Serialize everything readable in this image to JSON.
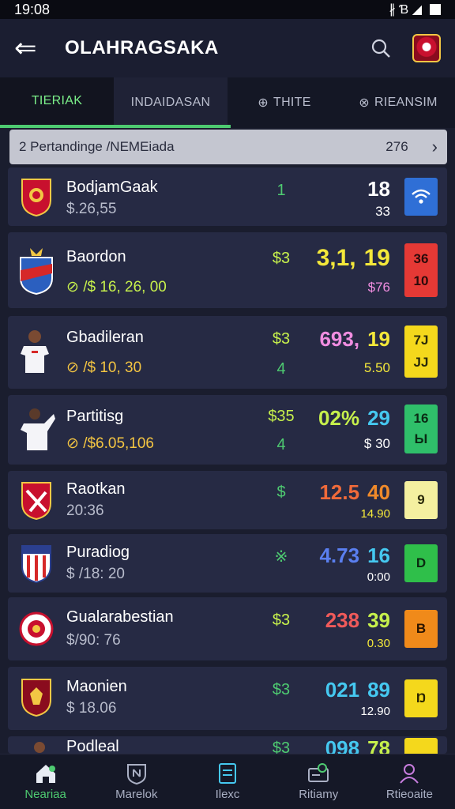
{
  "status": {
    "time": "19:08",
    "icons": "∦ Ɓ ◢"
  },
  "header": {
    "title": "OLAHRAGSAKA",
    "back": "⇐"
  },
  "tabs": [
    {
      "label": "TIERIAK",
      "icon": ""
    },
    {
      "label": "INDAIDASAN",
      "icon": ""
    },
    {
      "label": "THITE",
      "icon": "⊕"
    },
    {
      "label": "RIEANSIM",
      "icon": "⊗"
    }
  ],
  "summary": {
    "title": "2 Pertandinge /NEMEiada",
    "count": "276",
    "arrow": "›"
  },
  "rows": [
    {
      "name": "BodjamGaak",
      "sub": "$.26,55",
      "mid": "1",
      "score_a": "",
      "score_b": "18",
      "odds": "33",
      "box": "((·",
      "colors": {
        "mid": "#4ecb71",
        "score_a": "#ffffff",
        "score_b": "#ffffff",
        "box": "#2f6fd6",
        "sub": "#b8bccc"
      }
    },
    {
      "name": "Baordon",
      "sub": "⊘ /$ 16, 26, 00",
      "mid": "$3",
      "score_a": "3,1,",
      "score_b": "19",
      "odds": "$76",
      "box": "36\n10",
      "colors": {
        "mid": "#c6f04c",
        "score_a": "#f4e83a",
        "score_b": "#f4e83a",
        "box": "#e53935",
        "sub": "#c6f04c"
      }
    },
    {
      "name": "Gbadileran",
      "sub": "⊘ /$ 10, 30",
      "mid": "$3",
      "score_a": "693,",
      "score_b": "19",
      "odds": "5.50",
      "box": "7J\nJJ",
      "colors": {
        "mid": "#c6f04c",
        "score_a": "#f08de0",
        "score_b": "#f4e83a",
        "box": "#f4d81c",
        "sub": "#f4c542"
      }
    },
    {
      "name": "Partitisg",
      "sub": "⊘ /$6.05,106",
      "mid": "$35",
      "score_a": "02%",
      "score_b": "29",
      "odds": "$ 30",
      "box": "16\nЫ",
      "colors": {
        "mid": "#c6f04c",
        "score_a": "#c6f04c",
        "score_b": "#45c8f0",
        "box": "#2fbf6a",
        "sub": "#f4c542"
      }
    },
    {
      "name": "Raotkan",
      "sub": "20:36",
      "mid": "$",
      "score_a": "12.5",
      "score_b": "40",
      "odds": "14.90",
      "box": "9",
      "colors": {
        "mid": "#4ecb71",
        "score_a": "#f06a3a",
        "score_b": "#f08a2a",
        "box": "#f4f0a0",
        "sub": "#b8bccc"
      }
    },
    {
      "name": "Puradiog",
      "sub": "$ /18: 20",
      "mid": "※",
      "score_a": "4.73",
      "score_b": "16",
      "odds": "0:00",
      "box": "D",
      "colors": {
        "mid": "#4ecb71",
        "score_a": "#5a7ff0",
        "score_b": "#45c8f0",
        "box": "#2fbf4a",
        "sub": "#b8bccc"
      }
    },
    {
      "name": "Gualarabestian",
      "sub": "$/90: 76",
      "mid": "$3",
      "score_a": "238",
      "score_b": "39",
      "odds": "0.30",
      "box": "B",
      "colors": {
        "mid": "#c6f04c",
        "score_a": "#f05a5a",
        "score_b": "#c6f04c",
        "box": "#f08a1a",
        "sub": "#b8bccc"
      }
    },
    {
      "name": "Maonien",
      "sub": "$ 18.06",
      "mid": "$3",
      "score_a": "021",
      "score_b": "89",
      "odds": "12.90",
      "box": "Ŋ",
      "colors": {
        "mid": "#4ecb71",
        "score_a": "#45c8f0",
        "score_b": "#45c8f0",
        "box": "#f4d81c",
        "sub": "#b8bccc"
      }
    },
    {
      "name": "Podleal",
      "sub": "",
      "mid": "$3",
      "score_a": "098",
      "score_b": "78",
      "odds": "",
      "box": "",
      "colors": {
        "mid": "#4ecb71",
        "score_a": "#45c8f0",
        "score_b": "#c6f04c",
        "box": "#f4d81c",
        "sub": "#b8bccc"
      }
    }
  ],
  "nav": [
    {
      "label": "Neariaa",
      "icon": "home-icon"
    },
    {
      "label": "Marelok",
      "icon": "shield-icon"
    },
    {
      "label": "Ilexc",
      "icon": "document-icon"
    },
    {
      "label": "Ritiamy",
      "icon": "ticket-icon"
    },
    {
      "label": "Rtieoaite",
      "icon": "profile-icon"
    }
  ]
}
